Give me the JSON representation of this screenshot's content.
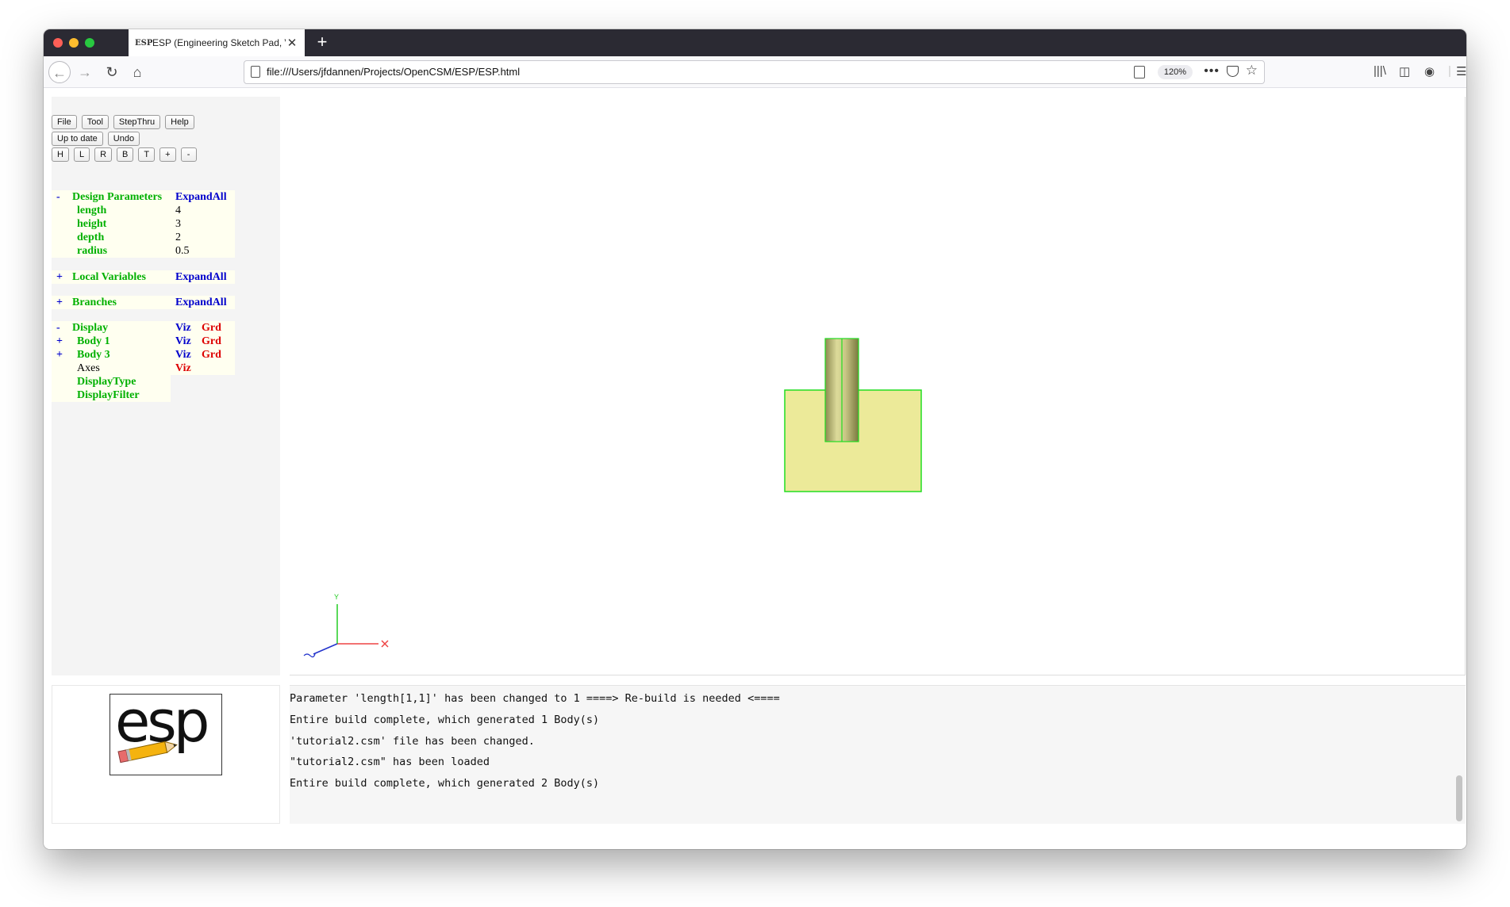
{
  "browser": {
    "tab_title": "ESP (Engineering Sketch Pad, V",
    "tab_favicon": "ESP",
    "url": "file:///Users/jfdannen/Projects/OpenCSM/ESP/ESP.html",
    "zoom": "120%"
  },
  "toolbar": {
    "row1": [
      "File",
      "Tool",
      "StepThru",
      "Help"
    ],
    "row2": [
      "Up to date",
      "Undo"
    ],
    "row3": [
      "H",
      "L",
      "R",
      "B",
      "T",
      "+",
      "-"
    ]
  },
  "tree": {
    "design_parameters": {
      "toggle": "-",
      "label": "Design Parameters",
      "action": "ExpandAll"
    },
    "params": [
      {
        "name": "length",
        "value": "4"
      },
      {
        "name": "height",
        "value": "3"
      },
      {
        "name": "depth",
        "value": "2"
      },
      {
        "name": "radius",
        "value": "0.5"
      }
    ],
    "local_variables": {
      "toggle": "+",
      "label": "Local Variables",
      "action": "ExpandAll"
    },
    "branches": {
      "toggle": "+",
      "label": "Branches",
      "action": "ExpandAll"
    },
    "display": {
      "toggle": "-",
      "label": "Display",
      "viz": "Viz",
      "grd": "Grd"
    },
    "bodies": [
      {
        "toggle": "+",
        "label": "Body 1",
        "viz": "Viz",
        "grd": "Grd"
      },
      {
        "toggle": "+",
        "label": "Body 3",
        "viz": "Viz",
        "grd": "Grd"
      }
    ],
    "axes": {
      "label": "Axes",
      "viz": "Viz"
    },
    "display_type": "DisplayType",
    "display_filter": "DisplayFilter"
  },
  "viewer": {
    "axis_y_label": "Y",
    "colors": {
      "box_fill": "#ecea99",
      "edge": "#22dd22",
      "x_axis": "#ee4444",
      "y_axis": "#22cc22",
      "z_axis": "#2233cc"
    }
  },
  "logo": {
    "text": "esp"
  },
  "messages": [
    "Parameter 'length[1,1]' has been changed to 1 ====> Re-build is needed <====",
    "Entire build complete, which generated 1 Body(s)",
    "'tutorial2.csm' file has been changed.",
    "\"tutorial2.csm\" has been loaded",
    "Entire build complete, which generated 2 Body(s)"
  ]
}
